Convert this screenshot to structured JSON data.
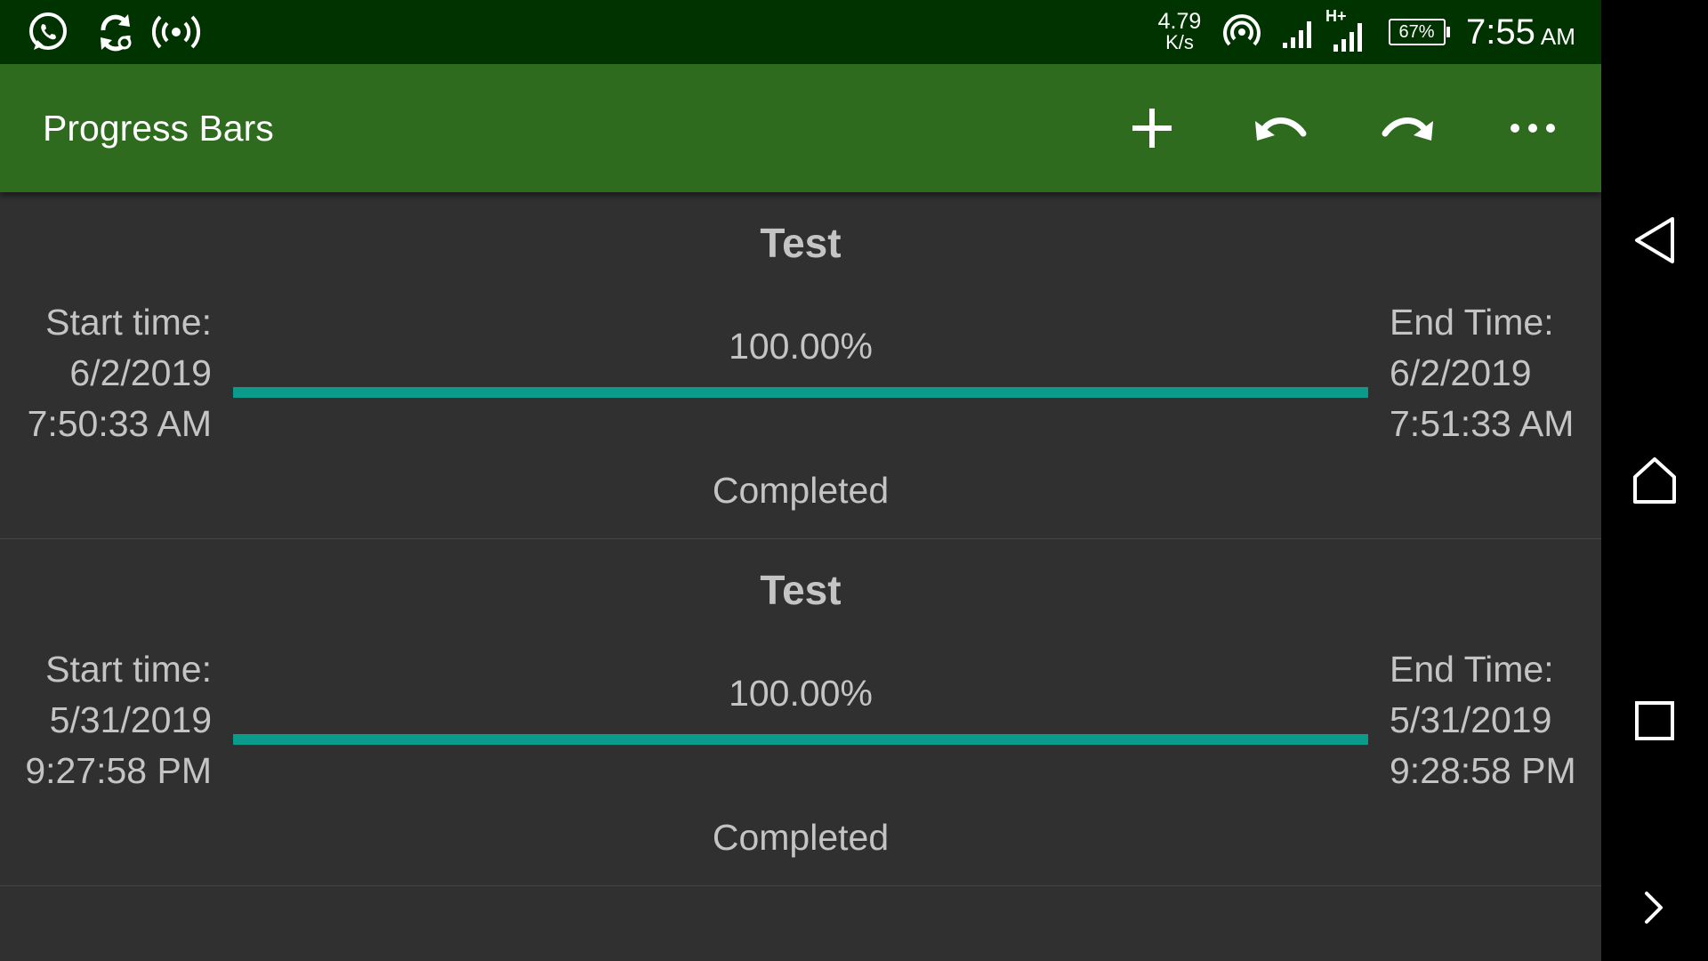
{
  "status_bar": {
    "network_speed": "4.79",
    "network_speed_unit": "K/s",
    "signal_type": "H+",
    "battery": "67%",
    "time": "7:55",
    "time_suffix": "AM",
    "icons": [
      "whatsapp-icon",
      "sync-icon",
      "hotspot-icon",
      "wifi-hotspot-icon",
      "signal-icon",
      "signal-hplus-icon",
      "battery-icon"
    ]
  },
  "app_bar": {
    "title": "Progress Bars",
    "actions": [
      "add-icon",
      "undo-icon",
      "redo-icon",
      "more-icon"
    ]
  },
  "items": [
    {
      "title": "Test",
      "start_label": "Start time:",
      "start_date": "6/2/2019",
      "start_time": "7:50:33 AM",
      "percent_text": "100.00%",
      "progress": 1.0,
      "end_label": "End Time:",
      "end_date": "6/2/2019",
      "end_time": "7:51:33 AM",
      "status": "Completed"
    },
    {
      "title": "Test",
      "start_label": "Start time:",
      "start_date": "5/31/2019",
      "start_time": "9:27:58 PM",
      "percent_text": "100.00%",
      "progress": 1.0,
      "end_label": "End Time:",
      "end_date": "5/31/2019",
      "end_time": "9:28:58 PM",
      "status": "Completed"
    }
  ],
  "nav_bar": [
    "back-icon",
    "home-icon",
    "recents-icon",
    "expand-icon"
  ],
  "colors": {
    "status_bar": "#013300",
    "app_bar": "#2e6b1f",
    "background": "#303030",
    "progress_fill": "#0a9b8a",
    "text": "#c4c4c4"
  }
}
